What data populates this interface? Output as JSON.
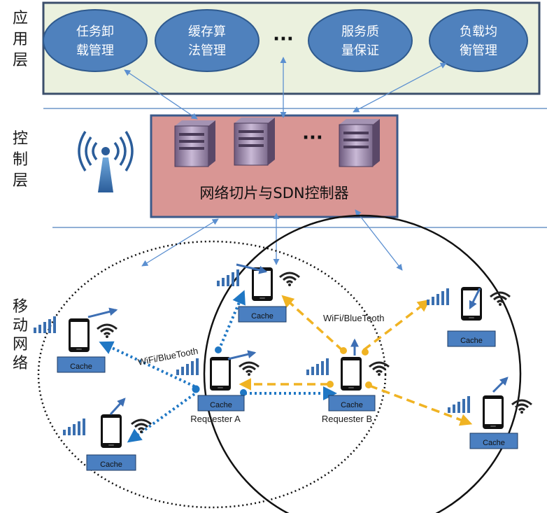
{
  "layers": {
    "application": "应用层",
    "control": "控制层",
    "mobile": "移动网络"
  },
  "app_services": [
    {
      "line1": "任务卸",
      "line2": "载管理"
    },
    {
      "line1": "缓存算",
      "line2": "法管理"
    },
    {
      "line1": "服务质",
      "line2": "量保证"
    },
    {
      "line1": "负载均",
      "line2": "衡管理"
    }
  ],
  "ellipsis": "···",
  "controller_label": "网络切片与SDN控制器",
  "cache_label": "Cache",
  "requester_a": "Requester A",
  "requester_b": "Requester B",
  "wifi_label_1": "WiFi/BlueTooth",
  "wifi_label_2": "WiFi/BlueTooth",
  "colors": {
    "app_bg": "#ebf1de",
    "app_border": "#3b4e6b",
    "ellipse": "#4f81bd",
    "ctrl_bg": "#d99694",
    "ctrl_border": "#3b5a8a",
    "blue_link": "#1f77c4",
    "orange_link": "#f0b323",
    "arrow_line": "#5b8fd0",
    "cache_box": "#4a7fc1"
  }
}
